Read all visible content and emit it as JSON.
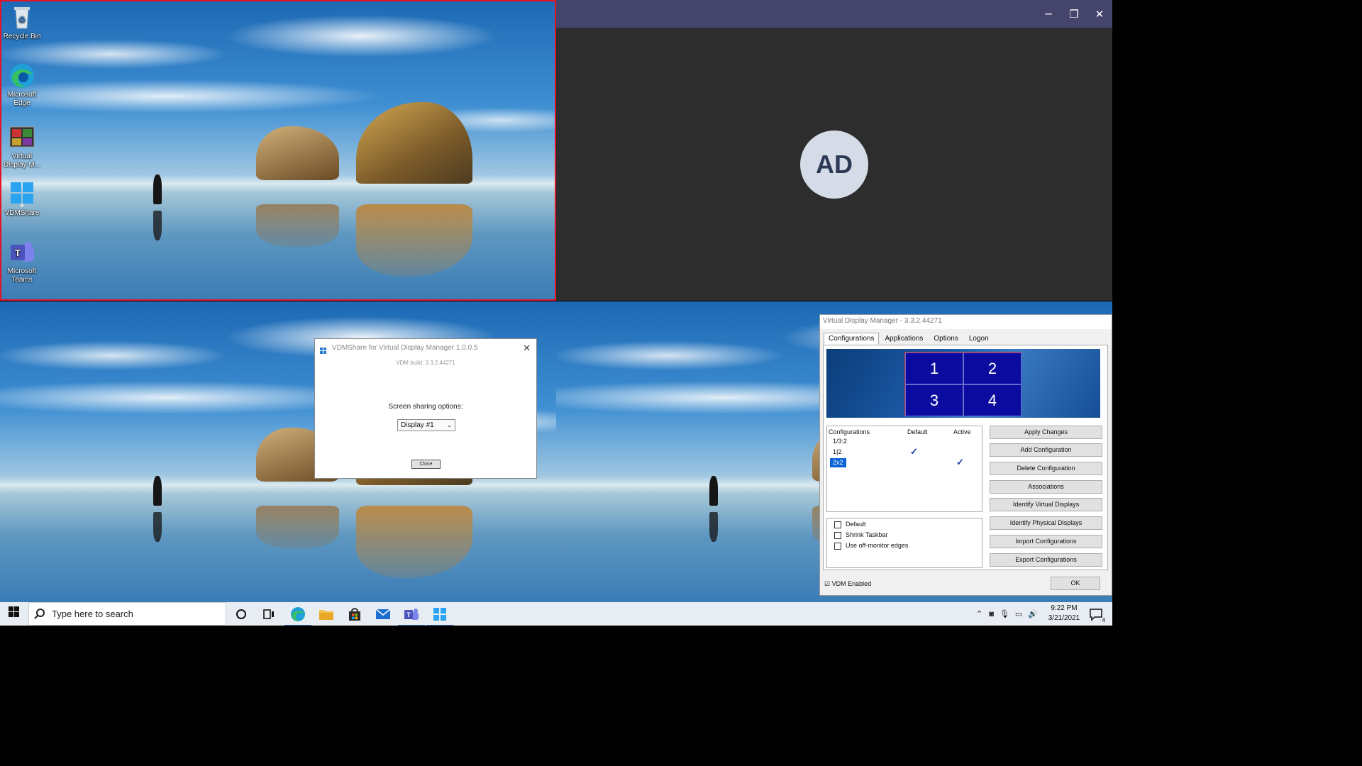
{
  "desktop_icons": [
    {
      "label": "Recycle Bin",
      "icon": "recycle-bin-icon"
    },
    {
      "label": "Microsoft Edge",
      "icon": "edge-icon"
    },
    {
      "label": "Virtual Display M...",
      "icon": "vdm-icon"
    },
    {
      "label": "VDMShare",
      "icon": "vdmshare-icon"
    },
    {
      "label": "Microsoft Teams",
      "icon": "teams-icon"
    }
  ],
  "teams": {
    "avatar_initials": "AD",
    "title_bar_color": "#45446d"
  },
  "vdmshare": {
    "title": "VDMShare for Virtual Display Manager 1.0.0.5",
    "build": "VDM build: 3.3.2.44271",
    "sharing_label": "Screen sharing options:",
    "selected_option": "Display #1",
    "close_label": "Close"
  },
  "vdm": {
    "title": "Virtual Display Manager - 3.3.2.44271",
    "tabs": [
      "Configurations",
      "Applications",
      "Options",
      "Logon"
    ],
    "preview_cells": [
      "1",
      "2",
      "3",
      "4"
    ],
    "list_headers": {
      "name": "Configurations",
      "default": "Default",
      "active": "Active"
    },
    "configurations": [
      {
        "name": "1/3:2",
        "default": false,
        "active": false
      },
      {
        "name": "1|2",
        "default": true,
        "active": false
      },
      {
        "name": "2x2",
        "default": false,
        "active": true,
        "selected": true
      }
    ],
    "options": [
      {
        "label": "Default",
        "checked": false
      },
      {
        "label": "Shrink Taskbar",
        "checked": false
      },
      {
        "label": "Use off-monitor edges",
        "checked": false
      }
    ],
    "buttons": [
      "Apply Changes",
      "Add Configuration",
      "Delete Configuration",
      "Associations",
      "Identify Virtual Displays",
      "Identify Physical Displays",
      "Import Configurations",
      "Export Configurations"
    ],
    "vdm_enabled_label": "VDM Enabled",
    "vdm_enabled": true,
    "ok_label": "OK"
  },
  "taskbar": {
    "search_placeholder": "Type here to search",
    "time": "9:22 PM",
    "date": "3/21/2021",
    "notification_count": "4",
    "pinned": [
      "cortana-icon",
      "task-view-icon",
      "edge-icon",
      "file-explorer-icon",
      "store-icon",
      "mail-icon",
      "teams-icon",
      "vdmshare-icon"
    ]
  }
}
